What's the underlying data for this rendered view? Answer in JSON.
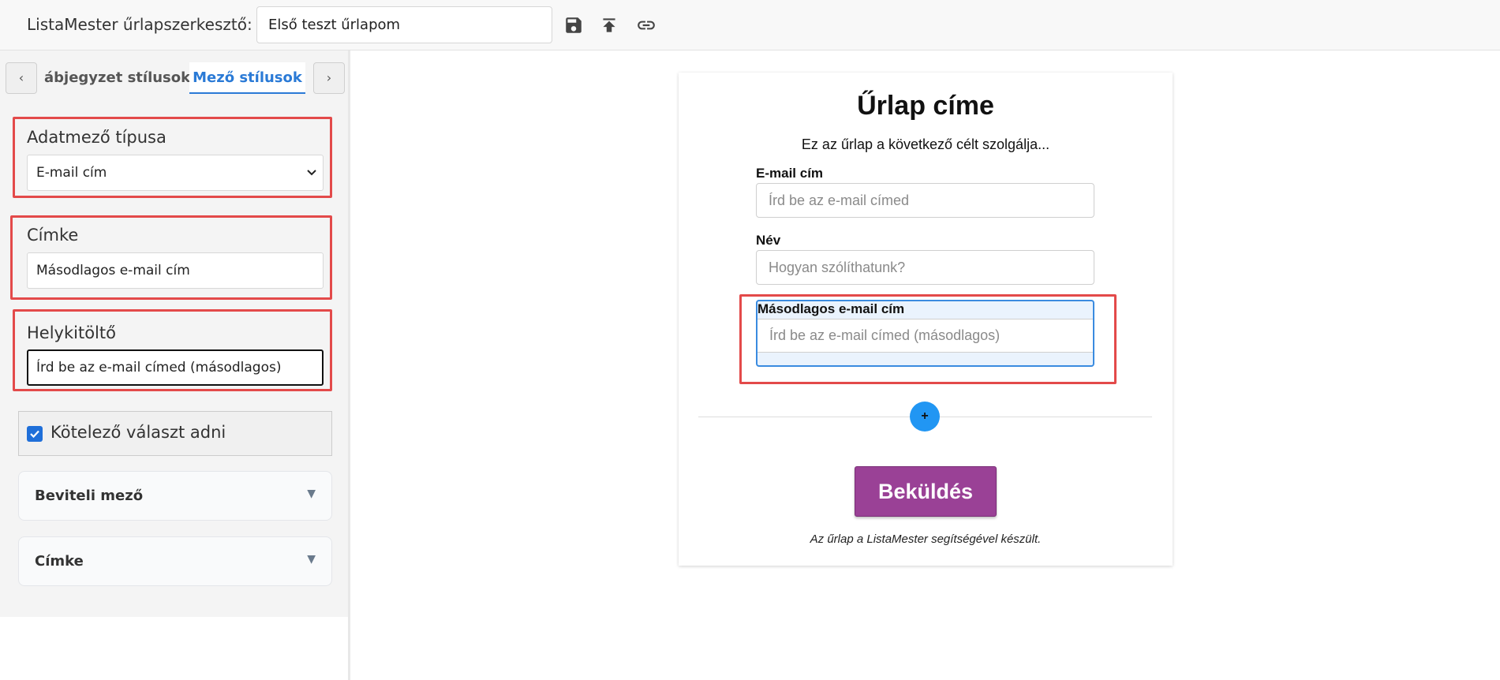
{
  "toolbar": {
    "app_title": "ListaMester űrlapszerkesztő:",
    "form_name": "Első teszt űrlapom",
    "icons": [
      "save-icon",
      "upload-icon",
      "link-icon"
    ]
  },
  "sidebar": {
    "tab_prev": "‹",
    "tab_next": "›",
    "tabs": [
      {
        "label": "ábjegyzet stílusok",
        "active": false
      },
      {
        "label": "Mező stílusok",
        "active": true
      }
    ],
    "field_type": {
      "label": "Adatmező típusa",
      "value": "E-mail cím"
    },
    "label_field": {
      "label": "Címke",
      "value": "Másodlagos e-mail cím"
    },
    "placeholder_field": {
      "label": "Helykitöltő",
      "value": "Írd be az e-mail címed (másodlagos)"
    },
    "required": {
      "label": "Kötelező választ adni",
      "checked": true
    },
    "accordions": [
      {
        "label": "Beviteli mező"
      },
      {
        "label": "Címke"
      }
    ]
  },
  "preview": {
    "title": "Űrlap címe",
    "description": "Ez az űrlap a következő célt szolgálja...",
    "fields": [
      {
        "label": "E-mail cím",
        "placeholder": "Írd be az e-mail címed"
      },
      {
        "label": "Név",
        "placeholder": "Hogyan szólíthatunk?"
      },
      {
        "label": "Másodlagos e-mail cím",
        "placeholder": "Írd be az e-mail címed (másodlagos)",
        "selected": true
      }
    ],
    "add_button": "+",
    "submit_label": "Beküldés",
    "footer": "Az űrlap a ListaMester segítségével készült."
  },
  "colors": {
    "accent": "#2a7ad6",
    "highlight": "#e34a4a",
    "submit": "#9a4196",
    "add_button": "#2196f3"
  }
}
